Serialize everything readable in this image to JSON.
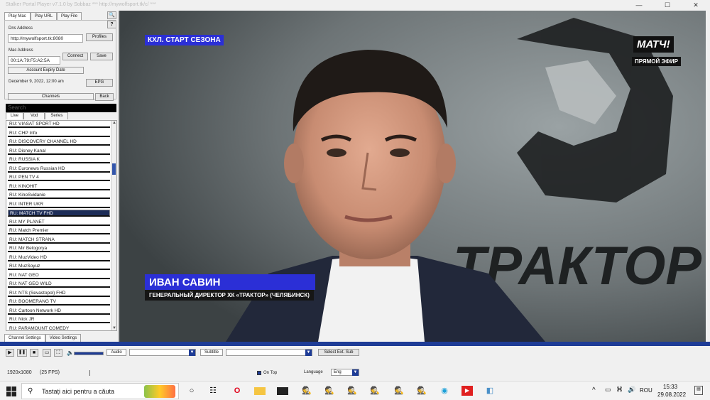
{
  "window": {
    "title": "Stalker Portal Player v7.1.0 by Sobbaz  ***  http://mywolfsport.tk/c/  ***",
    "min_glyph": "—",
    "max_glyph": "☐",
    "close_glyph": "✕"
  },
  "left": {
    "tabs": [
      "Play Mac",
      "Play URL",
      "Play File"
    ],
    "search_icon_glyph": "🔍",
    "help_glyph": "?",
    "portal_label": "Dns Address",
    "portal_value": "http://mywolfsport.tk:8080",
    "profiles_label": "Profiles",
    "mac_label": "Mac Address",
    "mac_value": "00:1A:79:F5:A2:5A",
    "connect_label": "Connect",
    "save_label": "Save",
    "expiry_label": "Account Expiry Date",
    "expiry_value": "December 9, 2022, 12:00 am",
    "epg_label": "EPG",
    "channels_label": "Channels",
    "back_label": "Back",
    "search_placeholder": "Search",
    "list_tabs": [
      "Live",
      "Vod",
      "Series"
    ],
    "channels": [
      "RU: VIASAT SPORT HD",
      "RU: CHP Info",
      "RU: DISCOVERY CHANNEL HD",
      "RU: Disney Kanal",
      "RU: RUSSIA K",
      "RU: Euronews Russian HD",
      "RU: PEN TV 4",
      "RU: KINOHIT",
      "RU: KinoSvidanie",
      "RU: INTER UKR",
      "RU: MATCH TV FHD",
      "RU: MY PLANET",
      "RU: Match Premier",
      "RU: MATCH STRANA",
      "RU: Mir Belogorya",
      "RU: MuzVideo HD",
      "RU: MuzSoyuz",
      "RU: NAT GEO",
      "RU: NAT GEO WILD",
      "RU: NTS (Sevastopol) FHD",
      "RU: BOOMERANG TV",
      "RU: Cartoon Network HD",
      "RU: Nick JR",
      "RU: PARAMOUNT COMEDY"
    ],
    "selected_index": 10,
    "bottom_tabs": [
      "Channel Settings",
      "Video Settings"
    ]
  },
  "video": {
    "top_caption": "КХЛ. СТАРТ СЕЗОНА",
    "logo": "МАТЧ!",
    "live_label": "ПРЯМОЙ ЭФИР",
    "name": "ИВАН САВИН",
    "subtitle": "ГЕНЕРАЛЬНЫЙ ДИРЕКТОР ХК «ТРАКТОР» (ЧЕЛЯБИНСК)",
    "wall_text": "ТРАКТОР"
  },
  "controls": {
    "play_glyph": "▶",
    "pause_glyph": "❚❚",
    "stop_glyph": "■",
    "screen_glyph": "▭",
    "fullscreen_glyph": "⛶",
    "volume_glyph": "🔈",
    "volume_level": 1.0,
    "audio_label": "Audio",
    "subtitle_label": "Subtitle",
    "select_ext_sub_label": "Select Ext. Sub",
    "resolution": "1920x1080",
    "fps": "(25 FPS)",
    "on_top_label": "On Top",
    "language_label": "Language",
    "language_value": "Eng"
  },
  "taskbar": {
    "search_placeholder": "Tastați aici pentru a căuta",
    "time": "15:33",
    "date": "29.08.2022",
    "lang": "ROU",
    "up_glyph": "^"
  },
  "colors": {
    "video_bg": "#262626",
    "caption_blue": "#2b2fd6",
    "selected_row": "#1d2d58",
    "accent_blue": "#1e3c96"
  }
}
